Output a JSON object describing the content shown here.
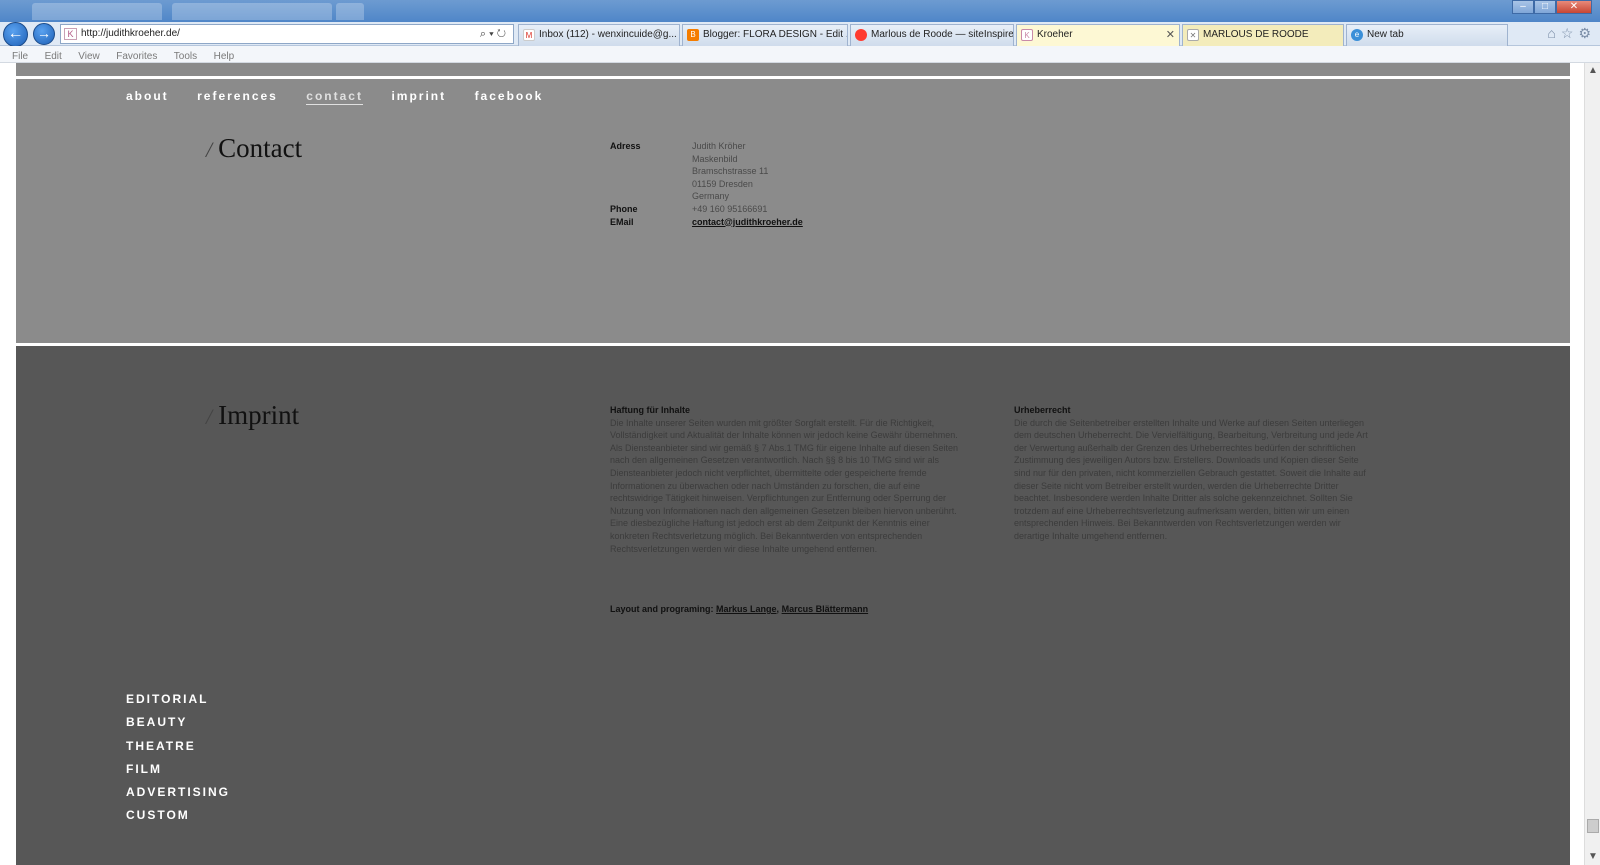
{
  "browser": {
    "address": "http://judithkroeher.de/",
    "tabs": [
      {
        "label": "Inbox (112) - wenxincuide@g...",
        "icon": "gmail-icon",
        "color": "#d93025"
      },
      {
        "label": "Blogger: FLORA DESIGN - Edit ...",
        "icon": "blogger-icon",
        "color": "#f57d00"
      },
      {
        "label": "Marlous de Roode — siteInspire",
        "icon": "siteinspire-icon",
        "color": "#ff3b30"
      },
      {
        "label": "Kroeher",
        "icon": "k-icon",
        "color": "#c98aa8"
      },
      {
        "label": "MARLOUS DE ROODE",
        "icon": "x-icon",
        "color": "#777777"
      },
      {
        "label": "New tab",
        "icon": "ie-icon",
        "color": "#3a8fd8"
      }
    ],
    "menu": [
      "File",
      "Edit",
      "View",
      "Favorites",
      "Tools",
      "Help"
    ]
  },
  "nav": {
    "items": [
      "about",
      "references",
      "contact",
      "imprint",
      "facebook"
    ]
  },
  "contact": {
    "title": "Contact",
    "adress_label": "Adress",
    "address_lines": [
      "Judith Kröher",
      "Maskenbild",
      "Bramschstrasse 11",
      "01159 Dresden",
      "Germany"
    ],
    "phone_label": "Phone",
    "phone": "+49 160 95166691",
    "email_label": "EMail",
    "email": "contact@judithkroeher.de"
  },
  "imprint": {
    "title": "Imprint",
    "liability_heading": "Haftung für Inhalte",
    "liability_text": "Die Inhalte unserer Seiten wurden mit größter Sorgfalt erstellt. Für die Richtigkeit, Vollständigkeit und Aktualität der Inhalte können wir jedoch keine Gewähr übernehmen. Als Diensteanbieter sind wir gemäß § 7 Abs.1 TMG für eigene Inhalte auf diesen Seiten nach den allgemeinen Gesetzen verantwortlich. Nach §§ 8 bis 10 TMG sind wir als Diensteanbieter jedoch nicht verpflichtet, übermittelte oder gespeicherte fremde Informationen zu überwachen oder nach Umständen zu forschen, die auf eine rechtswidrige Tätigkeit hinweisen. Verpflichtungen zur Entfernung oder Sperrung der Nutzung von Informationen nach den allgemeinen Gesetzen bleiben hiervon unberührt. Eine diesbezügliche Haftung ist jedoch erst ab dem Zeitpunkt der Kenntnis einer konkreten Rechtsverletzung möglich. Bei Bekanntwerden von entsprechenden Rechtsverletzungen werden wir diese Inhalte umgehend entfernen.",
    "copyright_heading": "Urheberrecht",
    "copyright_text": "Die durch die Seitenbetreiber erstellten Inhalte und Werke auf diesen Seiten unterliegen dem deutschen Urheberrecht. Die Vervielfältigung, Bearbeitung, Verbreitung und jede Art der Verwertung außerhalb der Grenzen des Urheberrechtes bedürfen der schriftlichen Zustimmung des jeweiligen Autors bzw. Erstellers. Downloads und Kopien dieser Seite sind nur für den privaten, nicht kommerziellen Gebrauch gestattet. Soweit die Inhalte auf dieser Seite nicht vom Betreiber erstellt wurden, werden die Urheberrechte Dritter beachtet. Insbesondere werden Inhalte Dritter als solche gekennzeichnet. Sollten Sie trotzdem auf eine Urheberrechtsverletzung aufmerksam werden, bitten wir um einen entsprechenden Hinweis. Bei Bekanntwerden von Rechtsverletzungen werden wir derartige Inhalte umgehend entfernen.",
    "credits_label": "Layout and programing:",
    "credit_1": "Markus Lange",
    "credit_sep": ",",
    "credit_2": "Marcus Blättermann"
  },
  "categories": [
    "EDITORIAL",
    "BEAUTY",
    "THEATRE",
    "FILM",
    "ADVERTISING",
    "CUSTOM"
  ],
  "colors": {
    "contact_bg": "#8b8b8b",
    "imprint_bg": "#575757",
    "nav_text": "#ffffff"
  }
}
